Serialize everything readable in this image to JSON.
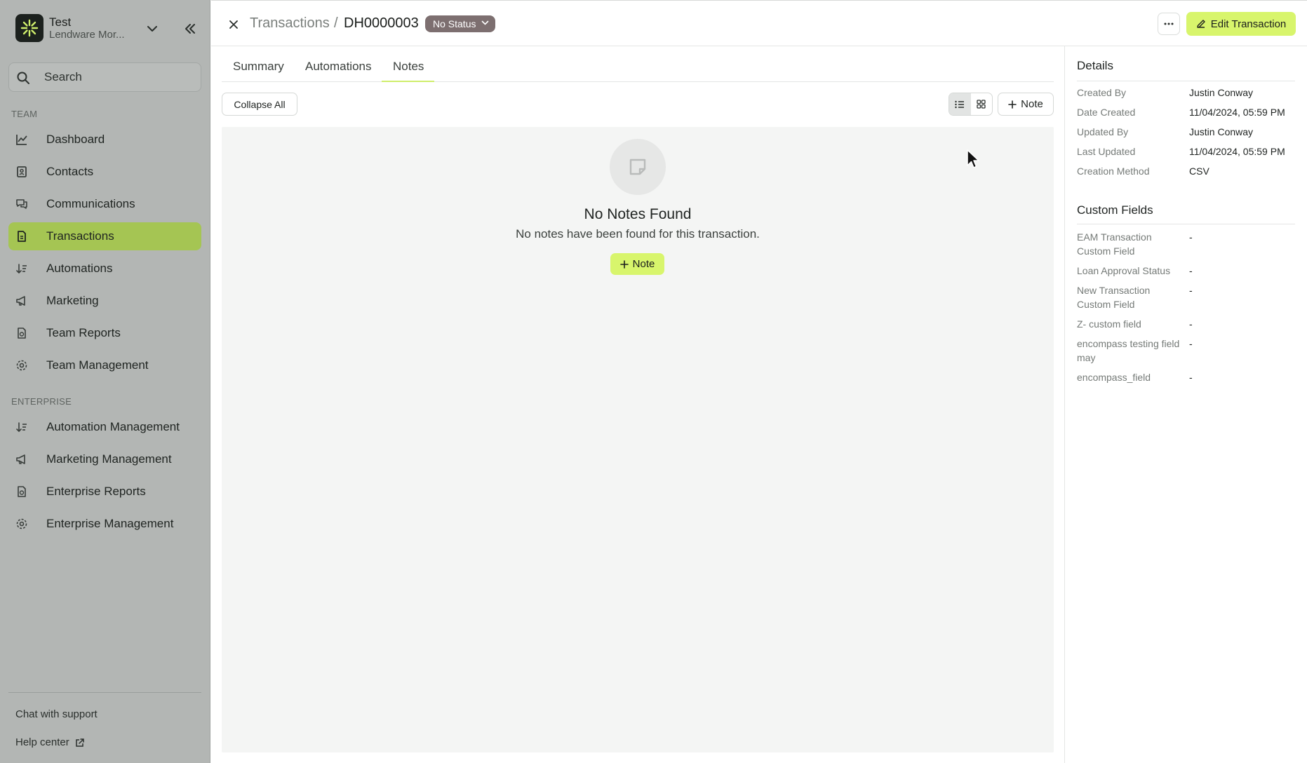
{
  "sidebar": {
    "org_name": "Test",
    "org_subtitle": "Lendware Mor...",
    "search_placeholder": "Search",
    "team_label": "TEAM",
    "enterprise_label": "ENTERPRISE",
    "team_items": [
      {
        "label": "Dashboard",
        "icon": "chart-line-icon"
      },
      {
        "label": "Contacts",
        "icon": "contact-card-icon"
      },
      {
        "label": "Communications",
        "icon": "chat-bubbles-icon"
      },
      {
        "label": "Transactions",
        "icon": "document-icon",
        "active": true
      },
      {
        "label": "Automations",
        "icon": "sort-arrows-icon"
      },
      {
        "label": "Marketing",
        "icon": "megaphone-icon"
      },
      {
        "label": "Team Reports",
        "icon": "report-icon"
      },
      {
        "label": "Team Management",
        "icon": "gear-icon"
      }
    ],
    "enterprise_items": [
      {
        "label": "Automation Management",
        "icon": "sort-arrows-icon"
      },
      {
        "label": "Marketing Management",
        "icon": "megaphone-icon"
      },
      {
        "label": "Enterprise Reports",
        "icon": "report-icon"
      },
      {
        "label": "Enterprise Management",
        "icon": "gear-icon"
      }
    ],
    "footer": {
      "chat_support": "Chat with support",
      "help_center": "Help center"
    }
  },
  "header": {
    "breadcrumb_parent": "Transactions",
    "breadcrumb_separator": "/",
    "breadcrumb_current": "DH0000003",
    "status": "No Status",
    "edit_button": "Edit Transaction"
  },
  "tabs": [
    {
      "label": "Summary"
    },
    {
      "label": "Automations"
    },
    {
      "label": "Notes",
      "active": true
    }
  ],
  "toolbar": {
    "collapse_all": "Collapse All",
    "add_note": "Note",
    "view_mode": "list"
  },
  "empty_state": {
    "title": "No Notes Found",
    "description": "No notes have been found for this transaction.",
    "button": "Note"
  },
  "details": {
    "title": "Details",
    "rows": [
      {
        "label": "Created By",
        "value": "Justin Conway"
      },
      {
        "label": "Date Created",
        "value": "11/04/2024, 05:59 PM"
      },
      {
        "label": "Updated By",
        "value": "Justin Conway"
      },
      {
        "label": "Last Updated",
        "value": "11/04/2024, 05:59 PM"
      },
      {
        "label": "Creation Method",
        "value": "CSV"
      }
    ]
  },
  "custom_fields": {
    "title": "Custom Fields",
    "rows": [
      {
        "label": "EAM Transaction Custom Field",
        "value": "-"
      },
      {
        "label": "Loan Approval Status",
        "value": "-"
      },
      {
        "label": "New Transaction Custom Field",
        "value": "-"
      },
      {
        "label": "Z- custom field",
        "value": "-"
      },
      {
        "label": "encompass testing field may",
        "value": "-"
      },
      {
        "label": "encompass_field",
        "value": "-"
      }
    ]
  },
  "colors": {
    "accent": "#d8f56c",
    "sidebar_active": "#a5c553",
    "sidebar_bg": "#b3b6b4",
    "status_pill": "#7d6f70"
  }
}
